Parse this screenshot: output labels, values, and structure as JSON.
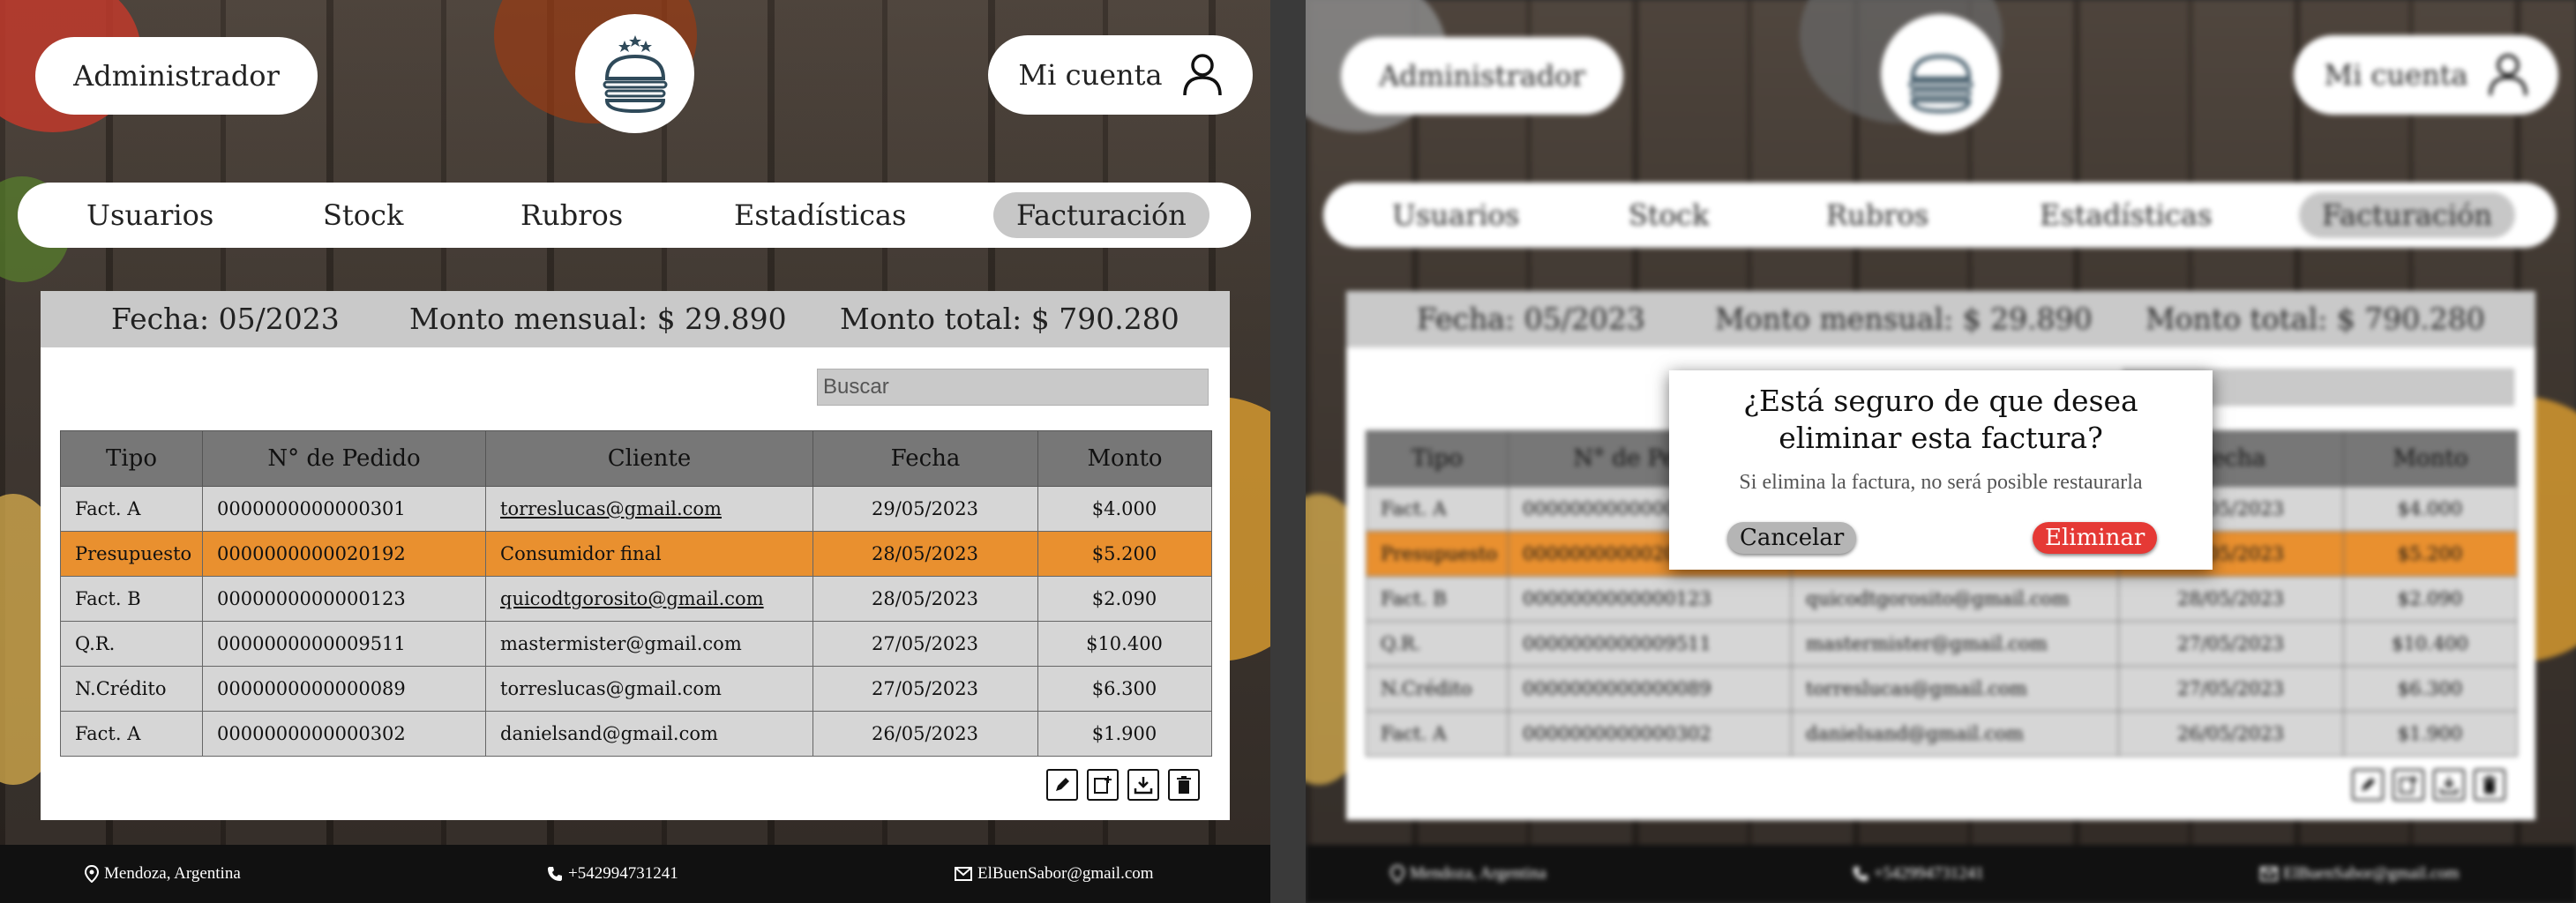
{
  "header": {
    "admin_label": "Administrador",
    "account_label": "Mi cuenta"
  },
  "nav": {
    "tabs": [
      {
        "label": "Usuarios"
      },
      {
        "label": "Stock"
      },
      {
        "label": "Rubros"
      },
      {
        "label": "Estadísticas"
      },
      {
        "label": "Facturación",
        "active": true
      }
    ]
  },
  "summary": {
    "fecha": "Fecha: 05/2023",
    "monto_mensual": "Monto mensual: $ 29.890",
    "monto_total": "Monto total: $ 790.280"
  },
  "search": {
    "placeholder": "Buscar"
  },
  "table": {
    "headers": [
      "Tipo",
      "N° de Pedido",
      "Cliente",
      "Fecha",
      "Monto"
    ],
    "rows": [
      [
        "Fact. A",
        "0000000000000301",
        "torreslucas@gmail.com",
        "29/05/2023",
        "$4.000"
      ],
      [
        "Presupuesto",
        "0000000000020192",
        "Consumidor final",
        "28/05/2023",
        "$5.200"
      ],
      [
        "Fact. B",
        "0000000000000123",
        "quicodtgorosito@gmail.com",
        "28/05/2023",
        "$2.090"
      ],
      [
        "Q.R.",
        "0000000000009511",
        "mastermister@gmail.com",
        "27/05/2023",
        "$10.400"
      ],
      [
        "N.Crédito",
        "0000000000000089",
        "torreslucas@gmail.com",
        "27/05/2023",
        "$6.300"
      ],
      [
        "Fact. A",
        "0000000000000302",
        "danielsand@gmail.com",
        "26/05/2023",
        "$1.900"
      ]
    ],
    "highlighted_row": 1,
    "highlight_color": "#e9902f"
  },
  "actions": [
    "edit-icon",
    "add-icon",
    "download-icon",
    "trash-icon"
  ],
  "footer": {
    "location": "Mendoza, Argentina",
    "phone": "+542994731241",
    "email": "ElBuenSabor@gmail.com"
  },
  "modal": {
    "question": "¿Está seguro de que desea eliminar esta factura?",
    "subtitle": "Si elimina la factura, no será posible restaurarla",
    "cancel_label": "Cancelar",
    "delete_label": "Eliminar",
    "delete_color": "#e53935",
    "cancel_color": "#b5b5b5"
  }
}
